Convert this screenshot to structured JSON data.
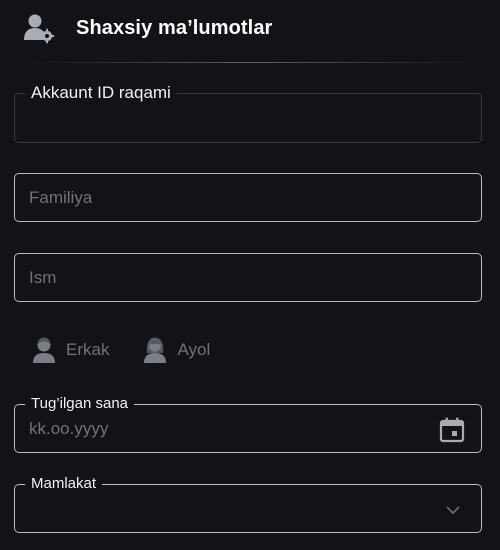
{
  "header": {
    "title": "Shaxsiy ma’lumotlar",
    "icon": "user-settings-icon"
  },
  "form": {
    "account_id": {
      "label": "Akkaunt ID raqami",
      "value": ""
    },
    "surname": {
      "placeholder": "Familiya",
      "value": ""
    },
    "name": {
      "placeholder": "Ism",
      "value": ""
    },
    "gender": {
      "options": [
        {
          "label": "Erkak",
          "icon": "male-avatar-icon"
        },
        {
          "label": "Ayol",
          "icon": "female-avatar-icon"
        }
      ],
      "selected": null
    },
    "birth_date": {
      "label": "Tug’ilgan sana",
      "placeholder": "kk.oo.yyyy",
      "icon": "calendar-icon"
    },
    "country": {
      "label": "Mamlakat",
      "value": "",
      "icon": "chevron-down-icon"
    }
  },
  "colors": {
    "background": "#121317",
    "text": "#ffffff",
    "muted": "#6f727a",
    "border_active": "#b9bbc0",
    "border_disabled": "#3a3c42"
  }
}
